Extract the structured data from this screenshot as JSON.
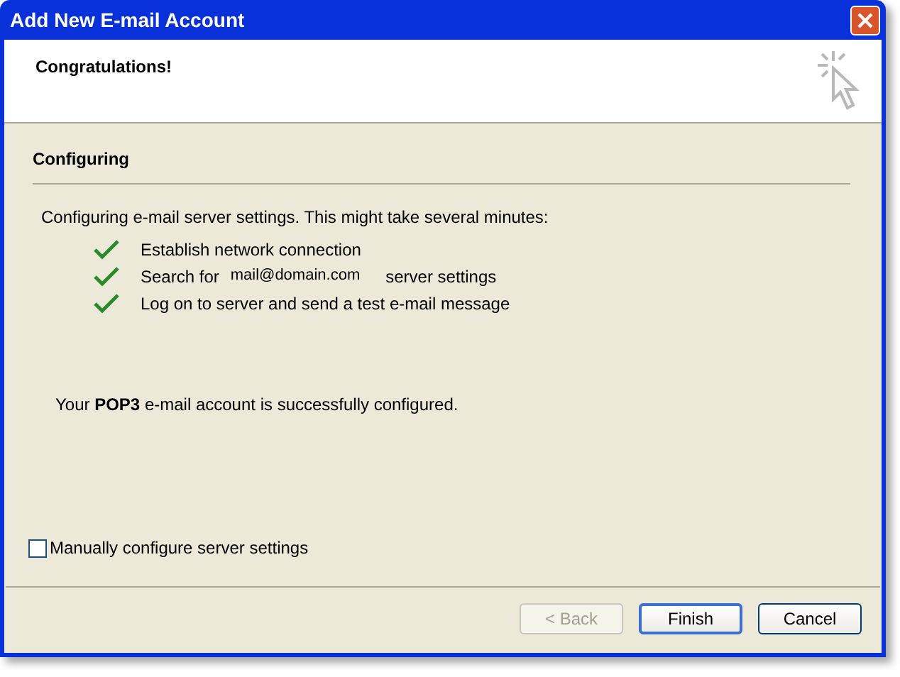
{
  "window": {
    "title": "Add New E-mail Account"
  },
  "header": {
    "title": "Congratulations!"
  },
  "section": {
    "title": "Configuring"
  },
  "intro": "Configuring e-mail server settings. This might take several minutes:",
  "steps": [
    {
      "done": true,
      "text": "Establish network connection"
    },
    {
      "done": true,
      "text": "Search for",
      "address": "mail@domain.com",
      "text_after": "server settings"
    },
    {
      "done": true,
      "text": "Log on to server and send a test e-mail message"
    }
  ],
  "result": "Your **POP3** e-mail account is successfully configured.",
  "manual_config": {
    "label": "Manually configure server settings",
    "checked": false
  },
  "buttons": [
    {
      "label": "< Back",
      "disabled": true,
      "default": false
    },
    {
      "label": "Finish",
      "disabled": false,
      "default": true
    },
    {
      "label": "Cancel",
      "disabled": false,
      "default": false
    }
  ]
}
